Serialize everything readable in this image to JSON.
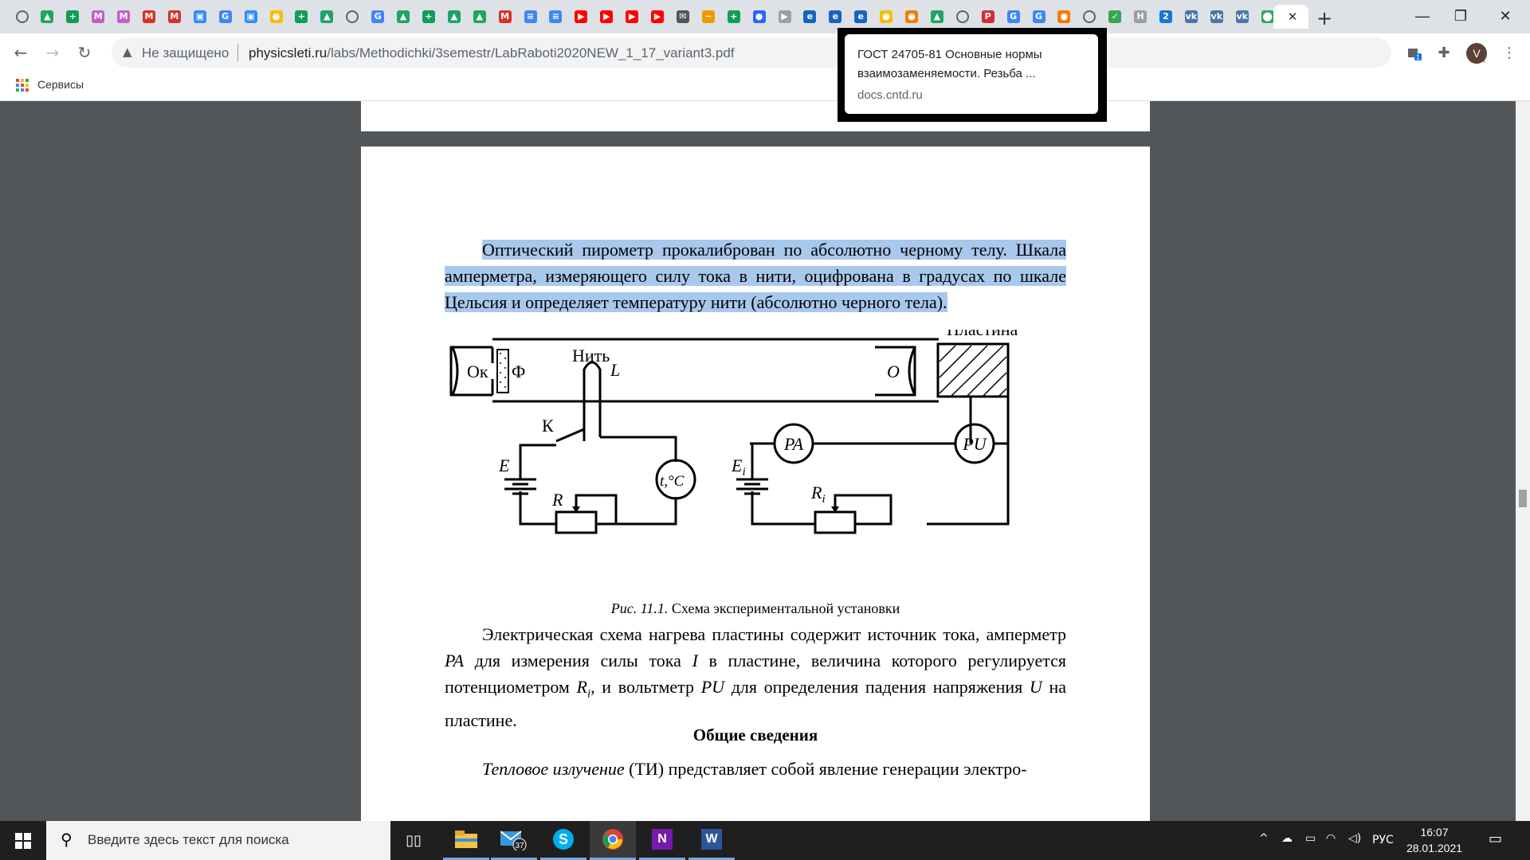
{
  "tabs": [
    {
      "icon": "globe-icon",
      "color": "#5f6368",
      "glyph": ""
    },
    {
      "icon": "drive-icon",
      "color": "#1fa463",
      "glyph": "▲"
    },
    {
      "icon": "sheets-plus-icon",
      "color": "#0f9d58",
      "glyph": "+"
    },
    {
      "icon": "miro-icon",
      "color": "#c45ec8",
      "glyph": "M"
    },
    {
      "icon": "miro-icon",
      "color": "#c45ec8",
      "glyph": "M"
    },
    {
      "icon": "gmail-icon",
      "color": "#d93025",
      "glyph": "M"
    },
    {
      "icon": "gmail-icon",
      "color": "#d93025",
      "glyph": "M"
    },
    {
      "icon": "zoom-icon",
      "color": "#2d8cff",
      "glyph": "▣"
    },
    {
      "icon": "google-icon",
      "color": "#4285f4",
      "glyph": "G"
    },
    {
      "icon": "zoom-icon",
      "color": "#2d8cff",
      "glyph": "▣"
    },
    {
      "icon": "keep-icon",
      "color": "#fbbc04",
      "glyph": "●"
    },
    {
      "icon": "sheets-plus-icon",
      "color": "#0f9d58",
      "glyph": "+"
    },
    {
      "icon": "drive-icon",
      "color": "#1fa463",
      "glyph": "▲"
    },
    {
      "icon": "globe-icon",
      "color": "#5f6368",
      "glyph": ""
    },
    {
      "icon": "google-icon",
      "color": "#4285f4",
      "glyph": "G"
    },
    {
      "icon": "drive-icon",
      "color": "#1fa463",
      "glyph": "▲"
    },
    {
      "icon": "sheets-plus-icon",
      "color": "#0f9d58",
      "glyph": "+"
    },
    {
      "icon": "drive-icon",
      "color": "#1fa463",
      "glyph": "▲"
    },
    {
      "icon": "drive-icon",
      "color": "#1fa463",
      "glyph": "▲"
    },
    {
      "icon": "gmail-icon",
      "color": "#d93025",
      "glyph": "M"
    },
    {
      "icon": "docs-icon",
      "color": "#4285f4",
      "glyph": "≡"
    },
    {
      "icon": "docs-icon",
      "color": "#4285f4",
      "glyph": "≡"
    },
    {
      "icon": "youtube-icon",
      "color": "#ff0000",
      "glyph": "▶"
    },
    {
      "icon": "youtube-icon",
      "color": "#ff0000",
      "glyph": "▶"
    },
    {
      "icon": "youtube-icon",
      "color": "#ff0000",
      "glyph": "▶"
    },
    {
      "icon": "youtube-icon",
      "color": "#ff0000",
      "glyph": "▶"
    },
    {
      "icon": "mail-icon",
      "color": "#555555",
      "glyph": "✉"
    },
    {
      "icon": "fish-icon",
      "color": "#f29900",
      "glyph": "~"
    },
    {
      "icon": "sheets-plus-icon",
      "color": "#0f9d58",
      "glyph": "+"
    },
    {
      "icon": "firebase-icon",
      "color": "#2962ff",
      "glyph": "●"
    },
    {
      "icon": "video-icon",
      "color": "#9e9e9e",
      "glyph": "▶"
    },
    {
      "icon": "edge-icon",
      "color": "#1565c0",
      "glyph": "e"
    },
    {
      "icon": "edge-icon",
      "color": "#1565c0",
      "glyph": "e"
    },
    {
      "icon": "edge-icon",
      "color": "#1565c0",
      "glyph": "e"
    },
    {
      "icon": "keep-icon",
      "color": "#fbbc04",
      "glyph": "●"
    },
    {
      "icon": "cloud-icon",
      "color": "#f57c00",
      "glyph": "●"
    },
    {
      "icon": "drive-icon",
      "color": "#1fa463",
      "glyph": "▲"
    },
    {
      "icon": "globe-icon",
      "color": "#5f6368",
      "glyph": ""
    },
    {
      "icon": "pdf24-icon",
      "color": "#d32f2f",
      "glyph": "P"
    },
    {
      "icon": "google-icon",
      "color": "#4285f4",
      "glyph": "G"
    },
    {
      "icon": "google-icon",
      "color": "#4285f4",
      "glyph": "G"
    },
    {
      "icon": "cookie-icon",
      "color": "#f57c00",
      "glyph": "●"
    },
    {
      "icon": "globe-icon",
      "color": "#5f6368",
      "glyph": ""
    },
    {
      "icon": "check-icon",
      "color": "#34a853",
      "glyph": "✓"
    },
    {
      "icon": "h-icon",
      "color": "#9e9e9e",
      "glyph": "H"
    },
    {
      "icon": "two-icon",
      "color": "#1976d2",
      "glyph": "2"
    },
    {
      "icon": "vk-icon",
      "color": "#4a76a8",
      "glyph": "vk"
    },
    {
      "icon": "vk-icon",
      "color": "#4a76a8",
      "glyph": "vk"
    },
    {
      "icon": "vk-icon",
      "color": "#4a76a8",
      "glyph": "vk"
    },
    {
      "icon": "maps-icon",
      "color": "#34a853",
      "glyph": "⬤"
    }
  ],
  "window": {
    "minimize": "—",
    "maximize": "❐",
    "close": "✕"
  },
  "toolbar": {
    "security_label": "Не защищено",
    "url_host": "physicsleti.ru",
    "url_path": "/labs/Methodichki/3semestr/LabRaboti2020NEW_1_17_variant3.pdf",
    "profile_initial": "V",
    "ext_badge": "1"
  },
  "bookmarks": {
    "apps_label": "Сервисы"
  },
  "tooltip": {
    "title": "ГОСТ 24705-81 Основные нормы взаимозаменяемости. Резьба ...",
    "domain": "docs.cntd.ru"
  },
  "document": {
    "para1_hl1": "Оптический пирометр прокалиброван по абсолютно черному телу.",
    "para1_hl2": " Шкала амперметра, измеряющего силу тока в нити, оцифрована в градусах по шкале Цельсия и определяет температуру нити (абсолютно черного тела).",
    "figure_labels": {
      "plate": "Пластина",
      "filament": "Нить",
      "eyepiece": "Ок",
      "filter": "Ф",
      "lens": "О",
      "L": "L",
      "key": "К",
      "E": "E",
      "R": "R",
      "thermometer": "t,°C",
      "Ei": "E",
      "Ei_sub": "i",
      "Ri": "R",
      "Ri_sub": "i",
      "PA": "PA",
      "PU": "PU"
    },
    "caption_prefix": "Рис. 11.1.",
    "caption_text": " Схема экспериментальной установки",
    "para2": {
      "t1": "Электрическая схема нагрева пластины содержит источник тока, амперметр ",
      "i1": "PA",
      "t2": " для измерения силы тока ",
      "i2": "I",
      "t3": " в пластине, величина которого регулируется потенциометром ",
      "i3": "R",
      "i3sub": "i",
      "t4": ", и вольтметр ",
      "i4": "PU",
      "t5": " для определения падения напряжения ",
      "i5": "U",
      "t6": " на пластине."
    },
    "heading": "Общие сведения",
    "para3_italic": "Тепловое излучение",
    "para3_text": " (ТИ) представляет собой явление генерации электро-"
  },
  "taskbar": {
    "search_placeholder": "Введите здесь текст для поиска",
    "mail_badge": "37",
    "language": "РУС",
    "time": "16:07",
    "date": "28.01.2021"
  }
}
